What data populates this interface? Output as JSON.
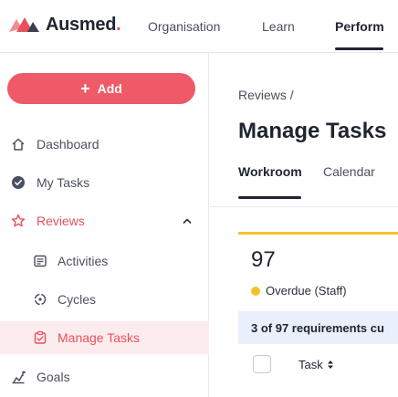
{
  "brand": {
    "name": "Ausmed",
    "dot": ".",
    "color": "#e8505b"
  },
  "topnav": {
    "items": [
      {
        "label": "Organisation",
        "active": false
      },
      {
        "label": "Learn",
        "active": false
      },
      {
        "label": "Perform",
        "active": true
      }
    ]
  },
  "sidebar": {
    "add_label": "Add",
    "items": [
      {
        "label": "Dashboard",
        "icon": "home-icon"
      },
      {
        "label": "My Tasks",
        "icon": "check-circle-icon"
      },
      {
        "label": "Reviews",
        "icon": "star-icon",
        "expanded": true
      },
      {
        "label": "Activities",
        "icon": "activity-icon"
      },
      {
        "label": "Cycles",
        "icon": "cycle-icon"
      },
      {
        "label": "Manage Tasks",
        "icon": "clipboard-icon",
        "active": true
      },
      {
        "label": "Goals",
        "icon": "goal-icon"
      }
    ]
  },
  "main": {
    "breadcrumb": "Reviews  /",
    "title": "Manage Tasks",
    "tabs": [
      {
        "label": "Workroom",
        "active": true
      },
      {
        "label": "Calendar",
        "active": false
      }
    ],
    "panel": {
      "count": "97",
      "status_label": "Overdue (Staff)",
      "summary": "3 of 97 requirements cu",
      "column_task": "Task"
    }
  },
  "colors": {
    "accent": "#ee5a67",
    "active_bg": "#fdecee",
    "overdue": "#f3c22b",
    "summary_bg": "#e9f0fb"
  }
}
